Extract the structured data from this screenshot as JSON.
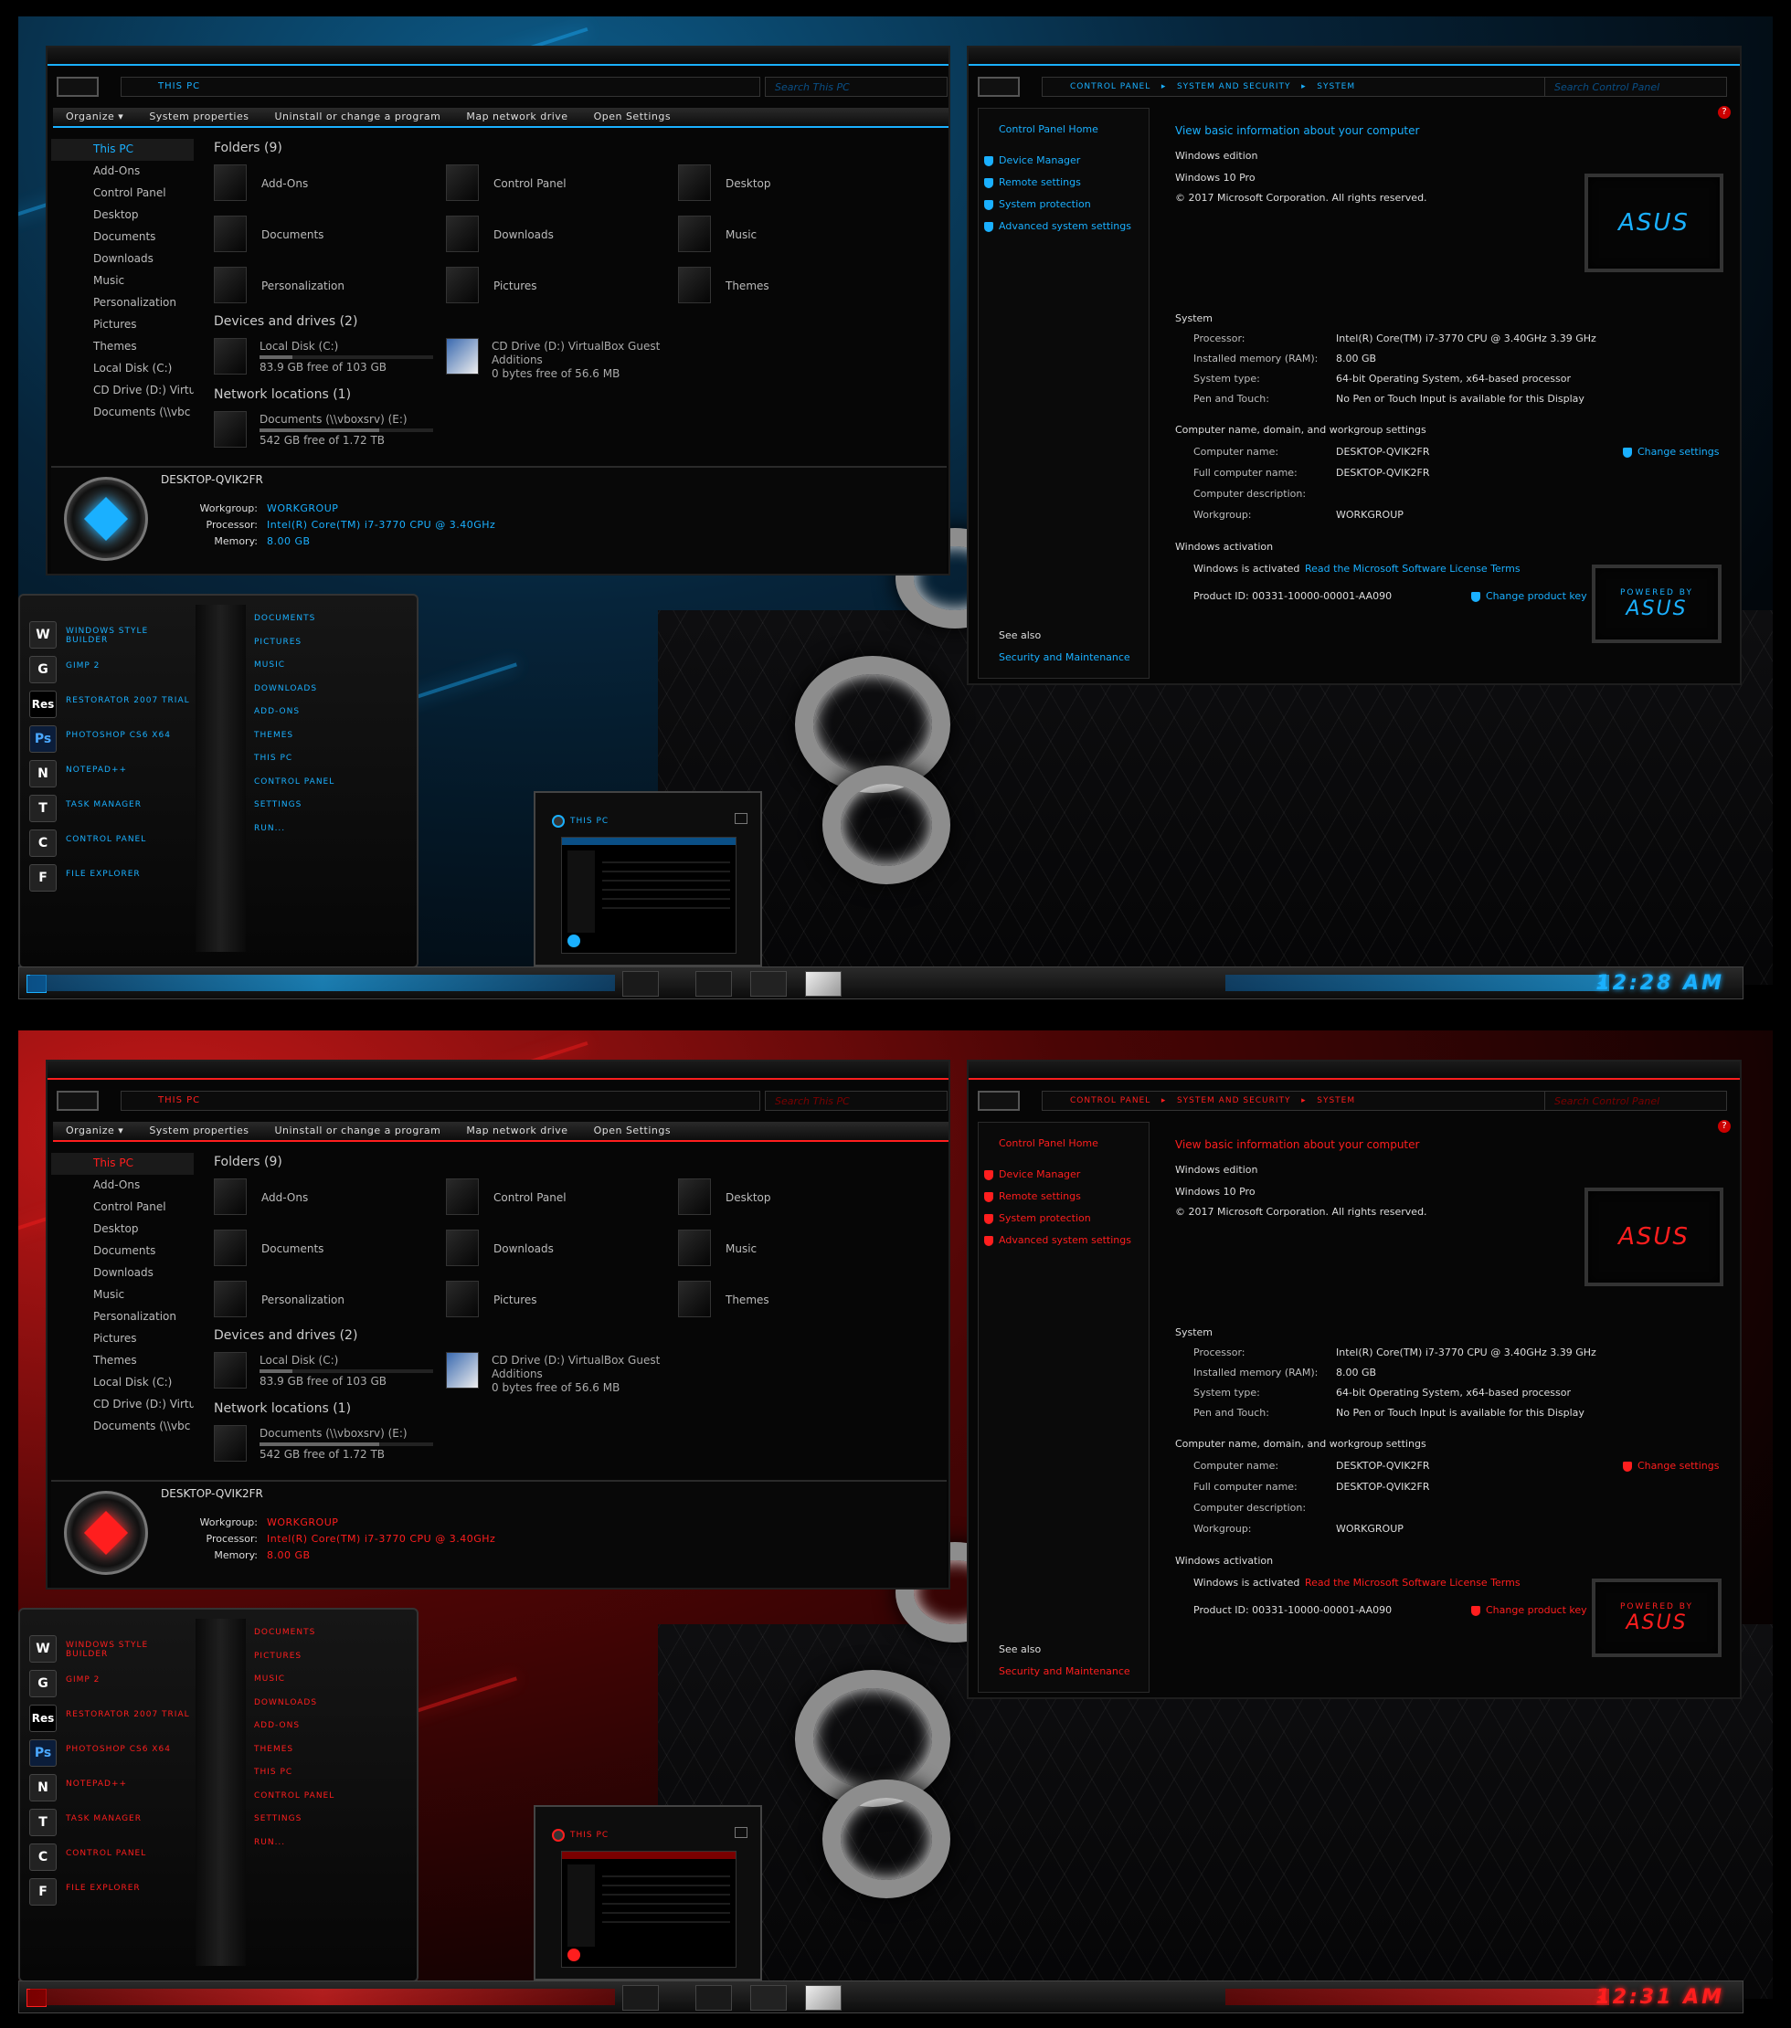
{
  "explorer": {
    "address": "THIS PC",
    "search_placeholder": "Search This PC",
    "commands": [
      "Organize ▾",
      "System properties",
      "Uninstall or change a program",
      "Map network drive",
      "Open Settings"
    ],
    "nav": [
      "This PC",
      "Add-Ons",
      "Control Panel",
      "Desktop",
      "Documents",
      "Downloads",
      "Music",
      "Personalization",
      "Pictures",
      "Themes",
      "Local Disk (C:)",
      "CD Drive (D:) Virtua",
      "Documents (\\\\vbc"
    ],
    "folders_header": "Folders (9)",
    "folders": [
      "Add-Ons",
      "Control Panel",
      "Desktop",
      "Documents",
      "Downloads",
      "Music",
      "Personalization",
      "Pictures",
      "Themes"
    ],
    "devices_header": "Devices and drives (2)",
    "drive_c": {
      "name": "Local Disk (C:)",
      "free": "83.9 GB free of 103 GB",
      "used_fraction": 0.19
    },
    "drive_d": {
      "name": "CD Drive (D:) VirtualBox Guest",
      "name2": "Additions",
      "free": "0 bytes free of 56.6 MB"
    },
    "network_header": "Network locations (1)",
    "net_drive": {
      "name": "Documents (\\\\vboxsrv) (E:)",
      "free": "542 GB free of 1.72 TB",
      "used_fraction": 0.69
    },
    "pc_name": "DESKTOP-QVIK2FR",
    "details": [
      {
        "label": "Workgroup:",
        "value": "WORKGROUP"
      },
      {
        "label": "Processor:",
        "value": "Intel(R) Core(TM) i7-3770 CPU @ 3.40GHz"
      },
      {
        "label": "Memory:",
        "value": "8.00 GB"
      }
    ]
  },
  "system": {
    "breadcrumb": [
      "CONTROL PANEL",
      "SYSTEM AND SECURITY",
      "SYSTEM"
    ],
    "search_placeholder": "Search Control Panel",
    "side": {
      "home": "Control Panel Home",
      "links": [
        "Device Manager",
        "Remote settings",
        "System protection",
        "Advanced system settings"
      ],
      "see_also": "See also",
      "security": "Security and Maintenance"
    },
    "heading": "View basic information about your computer",
    "edition_header": "Windows edition",
    "edition": "Windows 10 Pro",
    "copyright": "© 2017 Microsoft Corporation. All rights reserved.",
    "system_header": "System",
    "system_rows": [
      {
        "label": "Processor:",
        "value": "Intel(R) Core(TM) i7-3770 CPU @ 3.40GHz   3.39 GHz"
      },
      {
        "label": "Installed memory (RAM):",
        "value": "8.00 GB"
      },
      {
        "label": "System type:",
        "value": "64-bit Operating System, x64-based processor"
      },
      {
        "label": "Pen and Touch:",
        "value": "No Pen or Touch Input is available for this Display"
      }
    ],
    "name_header": "Computer name, domain, and workgroup settings",
    "name_rows": [
      {
        "label": "Computer name:",
        "value": "DESKTOP-QVIK2FR"
      },
      {
        "label": "Full computer name:",
        "value": "DESKTOP-QVIK2FR"
      },
      {
        "label": "Computer description:",
        "value": ""
      },
      {
        "label": "Workgroup:",
        "value": "WORKGROUP"
      }
    ],
    "change_settings": "Change settings",
    "activation_header": "Windows activation",
    "activated": "Windows is activated",
    "license_link": "Read the Microsoft Software License Terms",
    "product_id": "Product ID: 00331-10000-00001-AA090",
    "change_key": "Change product key",
    "logo": "ASUS",
    "powered_by": "POWERED BY",
    "powered_logo": "ASUS"
  },
  "start_menu": {
    "apps": [
      {
        "label": "WINDOWS STYLE BUILDER",
        "icon": "W",
        "arrow": false
      },
      {
        "label": "GIMP 2",
        "icon": "G",
        "arrow": true
      },
      {
        "label": "RESTORATOR 2007 TRIAL",
        "icon": "Res",
        "arrow": false
      },
      {
        "label": "PHOTOSHOP CS6 X64",
        "icon": "Ps",
        "arrow": false
      },
      {
        "label": "NOTEPAD++",
        "icon": "N",
        "arrow": false
      },
      {
        "label": "TASK MANAGER",
        "icon": "T",
        "arrow": false
      },
      {
        "label": "CONTROL PANEL",
        "icon": "C",
        "arrow": true
      },
      {
        "label": "FILE EXPLORER",
        "icon": "F",
        "arrow": true
      }
    ],
    "places": [
      "DOCUMENTS",
      "PICTURES",
      "MUSIC",
      "DOWNLOADS",
      "ADD-ONS",
      "THEMES",
      "THIS PC",
      "CONTROL PANEL",
      "SETTINGS",
      "RUN..."
    ]
  },
  "thumbnail": {
    "title": "THIS PC"
  },
  "clock_top": "12:28 AM",
  "clock_bottom": "12:31 AM",
  "colors": {
    "top_accent": "#1ab0ff",
    "bottom_accent": "#ff1e1e"
  }
}
